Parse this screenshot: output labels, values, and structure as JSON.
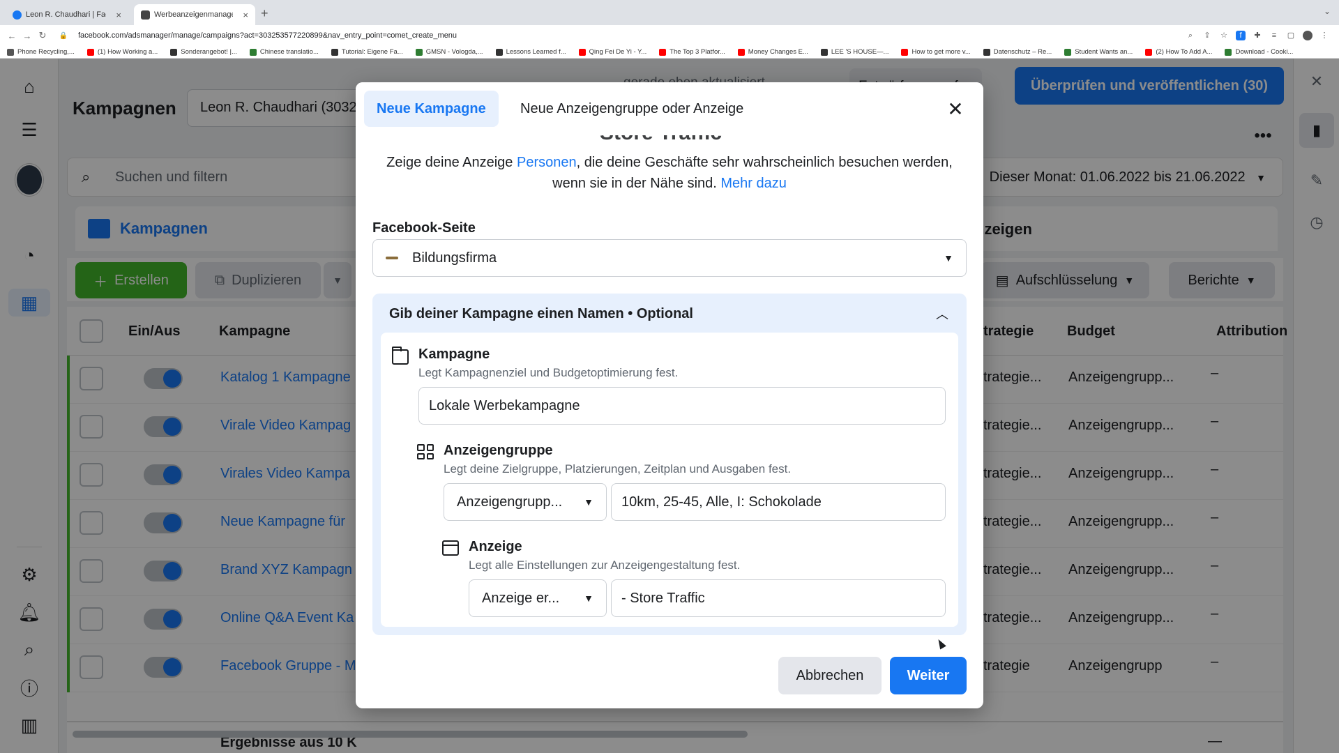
{
  "browser": {
    "tabs": [
      {
        "title": "Leon R. Chaudhari | Facebook",
        "color": "#1877f2"
      },
      {
        "title": "Werbeanzeigenmanager - Wer",
        "color": "#444444"
      }
    ],
    "url": "facebook.com/adsmanager/manage/campaigns?act=303253577220899&nav_entry_point=comet_create_menu",
    "bookmarks": [
      {
        "label": "Phone Recycling,...",
        "color": "#555555"
      },
      {
        "label": "(1) How Working a...",
        "color": "#ff0000"
      },
      {
        "label": "Sonderangebot! |...",
        "color": "#333333"
      },
      {
        "label": "Chinese translatio...",
        "color": "#2e7d32"
      },
      {
        "label": "Tutorial: Eigene Fa...",
        "color": "#333333"
      },
      {
        "label": "GMSN - Vologda,...",
        "color": "#2e7d32"
      },
      {
        "label": "Lessons Learned f...",
        "color": "#333333"
      },
      {
        "label": "Qing Fei De Yi - Y...",
        "color": "#ff0000"
      },
      {
        "label": "The Top 3 Platfor...",
        "color": "#ff0000"
      },
      {
        "label": "Money Changes E...",
        "color": "#ff0000"
      },
      {
        "label": "LEE 'S HOUSE—...",
        "color": "#333333"
      },
      {
        "label": "How to get more v...",
        "color": "#ff0000"
      },
      {
        "label": "Datenschutz – Re...",
        "color": "#333333"
      },
      {
        "label": "Student Wants an...",
        "color": "#2e7d32"
      },
      {
        "label": "(2) How To Add A...",
        "color": "#ff0000"
      },
      {
        "label": "Download - Cooki...",
        "color": "#2e7d32"
      }
    ]
  },
  "header": {
    "title": "Kampagnen",
    "account": "Leon R. Chaudhari (3032",
    "status": "gerade eben aktualisiert",
    "discard_label": "Entwürfe verwerfen",
    "publish_label": "Überprüfen und veröffentlichen (30)"
  },
  "search": {
    "placeholder": "Suchen und filtern",
    "date_range": "Dieser Monat: 01.06.2022 bis 21.06.2022"
  },
  "level_tabs": {
    "campaigns": "Kampagnen",
    "ads": "nzeigen"
  },
  "toolbar": {
    "create": "Erstellen",
    "duplicate": "Duplizieren",
    "breakdown": "Aufschlüsselung",
    "reports": "Berichte"
  },
  "table": {
    "headers": {
      "toggle": "Ein/Aus",
      "campaign": "Kampagne",
      "strategy": "trategie",
      "budget": "Budget",
      "attribution": "Attribution"
    },
    "rows": [
      {
        "name": "Katalog 1 Kampagne",
        "strategy": "trategie...",
        "budget": "Anzeigengrupp...",
        "attribution": "–"
      },
      {
        "name": "Virale Video Kampag",
        "strategy": "trategie...",
        "budget": "Anzeigengrupp...",
        "attribution": "–"
      },
      {
        "name": "Virales Video Kampa",
        "strategy": "trategie...",
        "budget": "Anzeigengrupp...",
        "attribution": "–"
      },
      {
        "name": "Neue Kampagne für",
        "strategy": "trategie...",
        "budget": "Anzeigengrupp...",
        "attribution": "–"
      },
      {
        "name": "Brand XYZ Kampagn",
        "strategy": "trategie...",
        "budget": "Anzeigengrupp...",
        "attribution": "–"
      },
      {
        "name": "Online Q&A Event Ka",
        "strategy": "trategie...",
        "budget": "Anzeigengrupp...",
        "attribution": "–"
      },
      {
        "name": "Facebook Gruppe - M",
        "strategy": "trategie",
        "budget": "Anzeigengrupp",
        "attribution": "–"
      }
    ],
    "results_label": "Ergebnisse aus 10 K",
    "results_attr": "—"
  },
  "modal": {
    "tab_new_campaign": "Neue Kampagne",
    "tab_new_adset": "Neue Anzeigengruppe oder Anzeige",
    "ghost_heading": "Store Traffic",
    "desc_pre": "Zeige deine Anzeige ",
    "desc_link": "Personen",
    "desc_mid": ", die deine Geschäfte sehr wahrscheinlich besuchen werden, wenn sie in der Nähe sind. ",
    "desc_more": "Mehr dazu",
    "fb_page_label": "Facebook-Seite",
    "fb_page_value": "Bildungsfirma",
    "name_section_title": "Gib deiner Kampagne einen Namen • Optional",
    "campaign": {
      "title": "Kampagne",
      "subtitle": "Legt Kampagnenziel und Budgetoptimierung fest.",
      "value": "Lokale Werbekampagne"
    },
    "adset": {
      "title": "Anzeigengruppe",
      "subtitle": "Legt deine Zielgruppe, Platzierungen, Zeitplan und Ausgaben fest.",
      "select": "Anzeigengrupp...",
      "value": "10km, 25-45, Alle, I: Schokolade"
    },
    "ad": {
      "title": "Anzeige",
      "subtitle": "Legt alle Einstellungen zur Anzeigengestaltung fest.",
      "select": "Anzeige er...",
      "value": "- Store Traffic"
    },
    "cancel": "Abbrechen",
    "next": "Weiter"
  }
}
